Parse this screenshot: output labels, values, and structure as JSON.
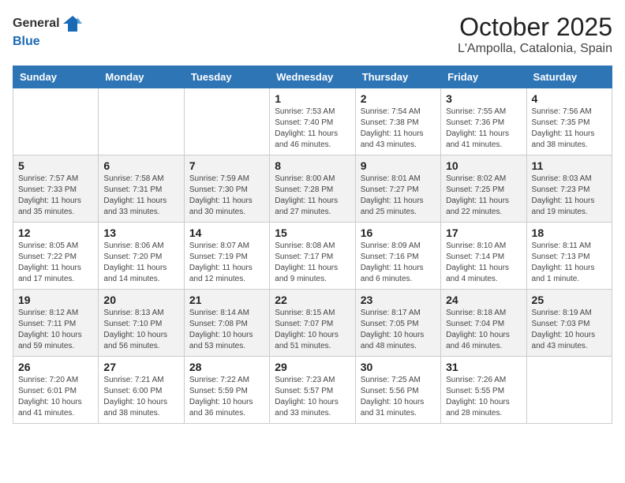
{
  "header": {
    "logo_general": "General",
    "logo_blue": "Blue",
    "month": "October 2025",
    "location": "L'Ampolla, Catalonia, Spain"
  },
  "weekdays": [
    "Sunday",
    "Monday",
    "Tuesday",
    "Wednesday",
    "Thursday",
    "Friday",
    "Saturday"
  ],
  "weeks": [
    [
      {
        "day": "",
        "info": ""
      },
      {
        "day": "",
        "info": ""
      },
      {
        "day": "",
        "info": ""
      },
      {
        "day": "1",
        "info": "Sunrise: 7:53 AM\nSunset: 7:40 PM\nDaylight: 11 hours\nand 46 minutes."
      },
      {
        "day": "2",
        "info": "Sunrise: 7:54 AM\nSunset: 7:38 PM\nDaylight: 11 hours\nand 43 minutes."
      },
      {
        "day": "3",
        "info": "Sunrise: 7:55 AM\nSunset: 7:36 PM\nDaylight: 11 hours\nand 41 minutes."
      },
      {
        "day": "4",
        "info": "Sunrise: 7:56 AM\nSunset: 7:35 PM\nDaylight: 11 hours\nand 38 minutes."
      }
    ],
    [
      {
        "day": "5",
        "info": "Sunrise: 7:57 AM\nSunset: 7:33 PM\nDaylight: 11 hours\nand 35 minutes."
      },
      {
        "day": "6",
        "info": "Sunrise: 7:58 AM\nSunset: 7:31 PM\nDaylight: 11 hours\nand 33 minutes."
      },
      {
        "day": "7",
        "info": "Sunrise: 7:59 AM\nSunset: 7:30 PM\nDaylight: 11 hours\nand 30 minutes."
      },
      {
        "day": "8",
        "info": "Sunrise: 8:00 AM\nSunset: 7:28 PM\nDaylight: 11 hours\nand 27 minutes."
      },
      {
        "day": "9",
        "info": "Sunrise: 8:01 AM\nSunset: 7:27 PM\nDaylight: 11 hours\nand 25 minutes."
      },
      {
        "day": "10",
        "info": "Sunrise: 8:02 AM\nSunset: 7:25 PM\nDaylight: 11 hours\nand 22 minutes."
      },
      {
        "day": "11",
        "info": "Sunrise: 8:03 AM\nSunset: 7:23 PM\nDaylight: 11 hours\nand 19 minutes."
      }
    ],
    [
      {
        "day": "12",
        "info": "Sunrise: 8:05 AM\nSunset: 7:22 PM\nDaylight: 11 hours\nand 17 minutes."
      },
      {
        "day": "13",
        "info": "Sunrise: 8:06 AM\nSunset: 7:20 PM\nDaylight: 11 hours\nand 14 minutes."
      },
      {
        "day": "14",
        "info": "Sunrise: 8:07 AM\nSunset: 7:19 PM\nDaylight: 11 hours\nand 12 minutes."
      },
      {
        "day": "15",
        "info": "Sunrise: 8:08 AM\nSunset: 7:17 PM\nDaylight: 11 hours\nand 9 minutes."
      },
      {
        "day": "16",
        "info": "Sunrise: 8:09 AM\nSunset: 7:16 PM\nDaylight: 11 hours\nand 6 minutes."
      },
      {
        "day": "17",
        "info": "Sunrise: 8:10 AM\nSunset: 7:14 PM\nDaylight: 11 hours\nand 4 minutes."
      },
      {
        "day": "18",
        "info": "Sunrise: 8:11 AM\nSunset: 7:13 PM\nDaylight: 11 hours\nand 1 minute."
      }
    ],
    [
      {
        "day": "19",
        "info": "Sunrise: 8:12 AM\nSunset: 7:11 PM\nDaylight: 10 hours\nand 59 minutes."
      },
      {
        "day": "20",
        "info": "Sunrise: 8:13 AM\nSunset: 7:10 PM\nDaylight: 10 hours\nand 56 minutes."
      },
      {
        "day": "21",
        "info": "Sunrise: 8:14 AM\nSunset: 7:08 PM\nDaylight: 10 hours\nand 53 minutes."
      },
      {
        "day": "22",
        "info": "Sunrise: 8:15 AM\nSunset: 7:07 PM\nDaylight: 10 hours\nand 51 minutes."
      },
      {
        "day": "23",
        "info": "Sunrise: 8:17 AM\nSunset: 7:05 PM\nDaylight: 10 hours\nand 48 minutes."
      },
      {
        "day": "24",
        "info": "Sunrise: 8:18 AM\nSunset: 7:04 PM\nDaylight: 10 hours\nand 46 minutes."
      },
      {
        "day": "25",
        "info": "Sunrise: 8:19 AM\nSunset: 7:03 PM\nDaylight: 10 hours\nand 43 minutes."
      }
    ],
    [
      {
        "day": "26",
        "info": "Sunrise: 7:20 AM\nSunset: 6:01 PM\nDaylight: 10 hours\nand 41 minutes."
      },
      {
        "day": "27",
        "info": "Sunrise: 7:21 AM\nSunset: 6:00 PM\nDaylight: 10 hours\nand 38 minutes."
      },
      {
        "day": "28",
        "info": "Sunrise: 7:22 AM\nSunset: 5:59 PM\nDaylight: 10 hours\nand 36 minutes."
      },
      {
        "day": "29",
        "info": "Sunrise: 7:23 AM\nSunset: 5:57 PM\nDaylight: 10 hours\nand 33 minutes."
      },
      {
        "day": "30",
        "info": "Sunrise: 7:25 AM\nSunset: 5:56 PM\nDaylight: 10 hours\nand 31 minutes."
      },
      {
        "day": "31",
        "info": "Sunrise: 7:26 AM\nSunset: 5:55 PM\nDaylight: 10 hours\nand 28 minutes."
      },
      {
        "day": "",
        "info": ""
      }
    ]
  ]
}
